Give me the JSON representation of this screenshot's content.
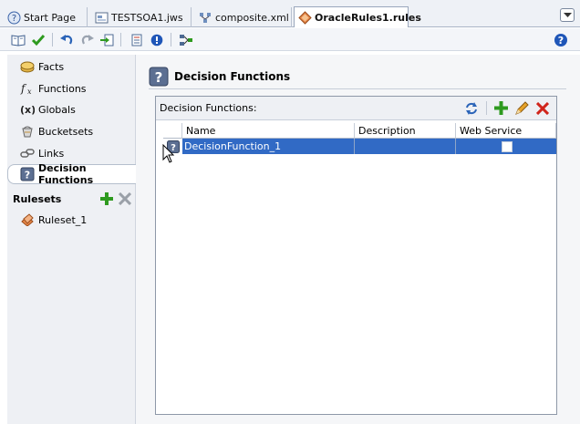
{
  "tabs": [
    {
      "label": "Start Page",
      "icon": "help-circle-icon"
    },
    {
      "label": "TESTSOA1.jws",
      "icon": "workspace-icon"
    },
    {
      "label": "composite.xml",
      "icon": "composite-icon"
    },
    {
      "label": "OracleRules1.rules",
      "icon": "rules-diamond-icon",
      "active": true
    }
  ],
  "nav": {
    "items": [
      {
        "label": "Facts",
        "icon": "facts-icon"
      },
      {
        "label": "Functions",
        "icon": "function-fx-icon"
      },
      {
        "label": "Globals",
        "icon": "globals-x-icon"
      },
      {
        "label": "Bucketsets",
        "icon": "bucketsets-icon"
      },
      {
        "label": "Links",
        "icon": "links-icon"
      },
      {
        "label": "Decision Functions",
        "icon": "decision-function-icon",
        "selected": true
      }
    ],
    "rulesets_label": "Rulesets",
    "rulesets": [
      {
        "label": "Ruleset_1",
        "icon": "ruleset-icon"
      }
    ]
  },
  "main": {
    "title": "Decision Functions",
    "panel_label": "Decision Functions:",
    "columns": [
      "Name",
      "Description",
      "Web Service"
    ],
    "rows": [
      {
        "name": "DecisionFunction_1",
        "description": "",
        "web_service": false,
        "selected": true
      }
    ]
  },
  "colors": {
    "selection": "#316ac5",
    "add": "#2e9a1f",
    "delete": "#d0241b",
    "accent": "#2b64b8"
  }
}
